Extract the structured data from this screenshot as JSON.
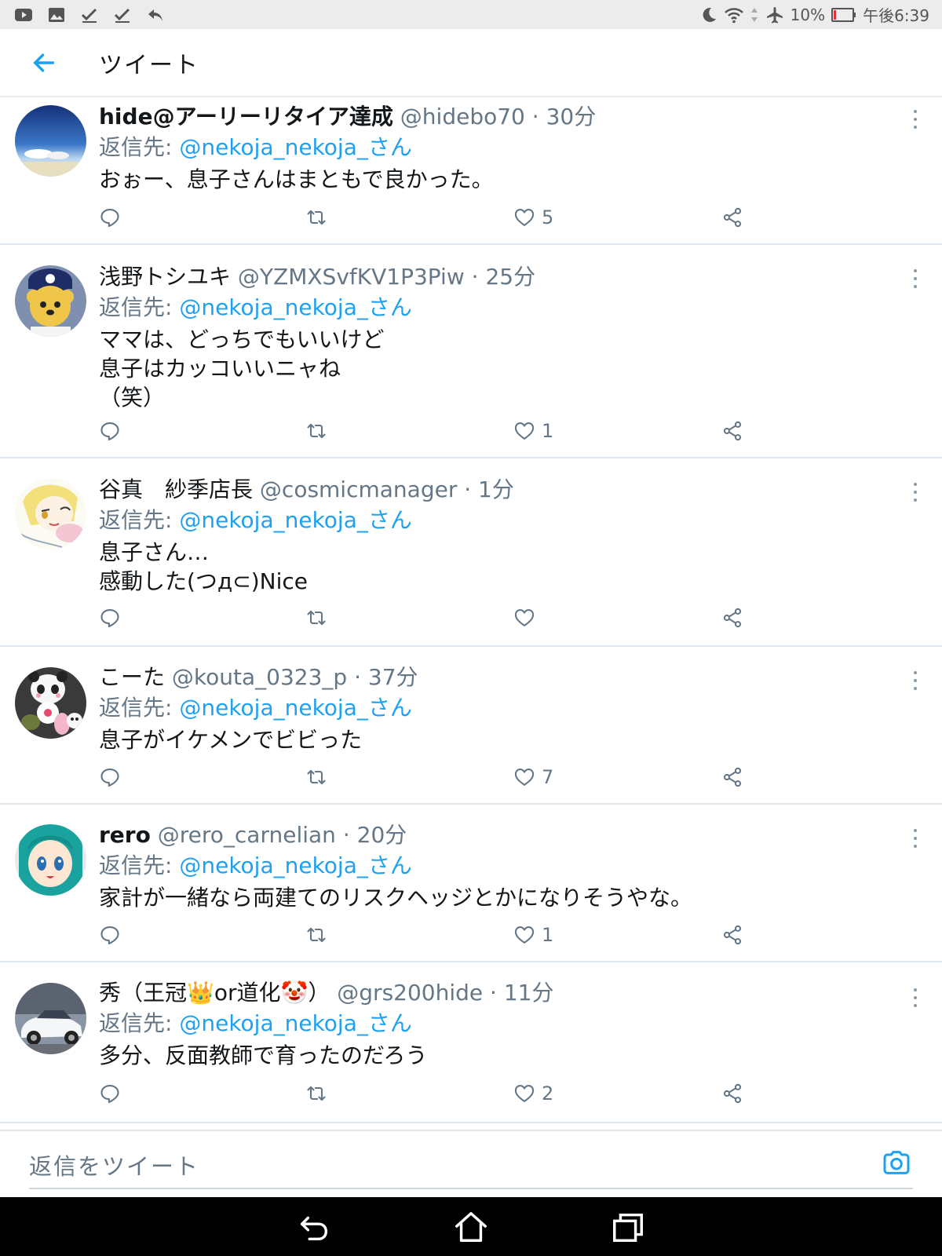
{
  "status_bar": {
    "battery": "10%",
    "time": "午後6:39"
  },
  "header": {
    "title": "ツイート"
  },
  "tweets": [
    {
      "name": "hide@アーリーリタイア達成",
      "handle": "@hidebo70",
      "time": "· 30分",
      "reply_prefix": "返信先: ",
      "reply_to": "@nekoja_nekoja_さん",
      "text": "おぉー、息子さんはまともで良かった。",
      "likes": "5"
    },
    {
      "name": "浅野トシユキ",
      "handle": "@YZMXSvfKV1P3Piw",
      "time": "· 25分",
      "reply_prefix": "返信先: ",
      "reply_to": "@nekoja_nekoja_さん",
      "text": "ママは、どっちでもいいけど\n息子はカッコいいニャね\n（笑）",
      "likes": "1"
    },
    {
      "name": "谷真　紗季店長",
      "handle": "@cosmicmanager",
      "time": "· 1分",
      "reply_prefix": "返信先: ",
      "reply_to": "@nekoja_nekoja_さん",
      "text": "息子さん…\n感動した(つд⊂)Nice",
      "likes": ""
    },
    {
      "name": "こーた",
      "handle": "@kouta_0323_p",
      "time": "· 37分",
      "reply_prefix": "返信先: ",
      "reply_to": "@nekoja_nekoja_さん",
      "text": "息子がイケメンでビビった",
      "likes": "7"
    },
    {
      "name": "rero",
      "handle": "@rero_carnelian",
      "time": "· 20分",
      "reply_prefix": "返信先: ",
      "reply_to": "@nekoja_nekoja_さん",
      "text": "家計が一緒なら両建てのリスクヘッジとかになりそうやな。",
      "likes": "1"
    },
    {
      "name": "秀（王冠👑or道化🤡）",
      "handle": "@grs200hide",
      "time": "· 11分",
      "reply_prefix": "返信先: ",
      "reply_to": "@nekoja_nekoja_さん",
      "text": "多分、反面教師で育ったのだろう",
      "likes": "2"
    }
  ],
  "compose": {
    "placeholder": "返信をツイート"
  },
  "colors": {
    "accent": "#1da1f2",
    "secondary_text": "#657786",
    "primary_text": "#14171a"
  }
}
